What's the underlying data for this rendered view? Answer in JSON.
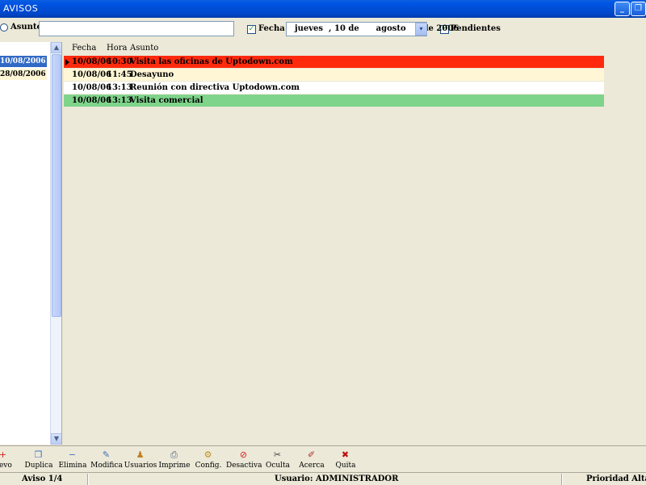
{
  "window": {
    "title": "AVISOS",
    "min_glyph": "_",
    "max_glyph": "❐",
    "close_glyph": "✕"
  },
  "filter": {
    "asunto_label": "Asunto:",
    "asunto_value": "",
    "fecha_label": "Fecha",
    "fecha_checked": true,
    "date_day_name": "jueves",
    "date_text": "jueves  , 10 de      agosto      de 2006",
    "pendientes_label": "Pendientes",
    "pendientes_checked": true,
    "check_glyph": "✓",
    "dropdown_glyph": "▾"
  },
  "date_list": [
    "10/08/2006",
    "28/08/2006"
  ],
  "grid": {
    "headers": [
      "Fecha",
      "Hora",
      "Asunto"
    ],
    "rows": [
      {
        "fecha": "10/08/06",
        "hora": "10:30",
        "asunto": "Visita las oficinas de Uptodown.com",
        "color": "#ff2a0e",
        "current": true
      },
      {
        "fecha": "10/08/06",
        "hora": "11:45",
        "asunto": "Desayuno",
        "color": "#fff6d6",
        "current": false
      },
      {
        "fecha": "10/08/06",
        "hora": "13:13",
        "asunto": "Reunión con directiva Uptodown.com",
        "color": "#ffffff",
        "current": false
      },
      {
        "fecha": "10/08/06",
        "hora": "13:13",
        "asunto": "Visita comercial",
        "color": "#7fd48c",
        "current": false
      }
    ]
  },
  "toolbar": [
    {
      "label": "uevo",
      "icon": "nuevo-icon",
      "glyph": "+",
      "color": "#d02020"
    },
    {
      "label": "Duplica",
      "icon": "duplica-icon",
      "glyph": "❐",
      "color": "#3a6fc0"
    },
    {
      "label": "Elimina",
      "icon": "elimina-icon",
      "glyph": "−",
      "color": "#3a6fc0"
    },
    {
      "label": "Modifica",
      "icon": "modifica-icon",
      "glyph": "✎",
      "color": "#3a6fc0"
    },
    {
      "label": "Usuarios",
      "icon": "usuarios-icon",
      "glyph": "♟",
      "color": "#c08020"
    },
    {
      "label": "Imprime",
      "icon": "imprime-icon",
      "glyph": "⎙",
      "color": "#506080"
    },
    {
      "label": "Config.",
      "icon": "config-icon",
      "glyph": "⚙",
      "color": "#c09020"
    },
    {
      "label": "Desactiva",
      "icon": "desactiva-icon",
      "glyph": "⊘",
      "color": "#d02020"
    },
    {
      "label": "Oculta",
      "icon": "oculta-icon",
      "glyph": "✂",
      "color": "#404040"
    },
    {
      "label": "Acerca",
      "icon": "acerca-icon",
      "glyph": "✐",
      "color": "#b03030"
    },
    {
      "label": "Quita",
      "icon": "quita-icon",
      "glyph": "✖",
      "color": "#c01010"
    }
  ],
  "status": {
    "aviso": "Aviso 1/4",
    "usuario": "Usuario: ADMINISTRADOR",
    "prioridad": "Prioridad Alta"
  },
  "scroll": {
    "up_glyph": "▲",
    "down_glyph": "▼"
  }
}
